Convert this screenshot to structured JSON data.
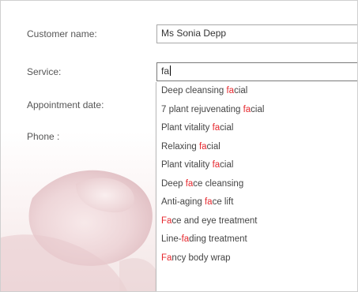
{
  "form": {
    "customer_name_label": "Customer name:",
    "customer_name_value": "Ms Sonia Depp",
    "service_label": "Service:",
    "service_value": "fa",
    "appointment_date_label": "Appointment date:",
    "phone_label": "Phone :"
  },
  "suggestions": [
    {
      "before": "Deep cleansing ",
      "match": "fa",
      "after": "cial"
    },
    {
      "before": "7 plant rejuvenating ",
      "match": "fa",
      "after": "cial"
    },
    {
      "before": "Plant vitality ",
      "match": "fa",
      "after": "cial"
    },
    {
      "before": "Relaxing ",
      "match": "fa",
      "after": "cial"
    },
    {
      "before": "Plant vitality ",
      "match": "fa",
      "after": "cial"
    },
    {
      "before": "Deep ",
      "match": "fa",
      "after": "ce cleansing"
    },
    {
      "before": "Anti-aging ",
      "match": "fa",
      "after": "ce lift"
    },
    {
      "before": "",
      "match": "Fa",
      "after": "ce and eye treatment"
    },
    {
      "before": "Line-",
      "match": "fa",
      "after": "ding treatment"
    },
    {
      "before": "",
      "match": "Fa",
      "after": "ncy body wrap"
    }
  ],
  "colors": {
    "match_highlight": "#e6282e",
    "label_text": "#555555",
    "field_border": "#a8a8a8"
  }
}
